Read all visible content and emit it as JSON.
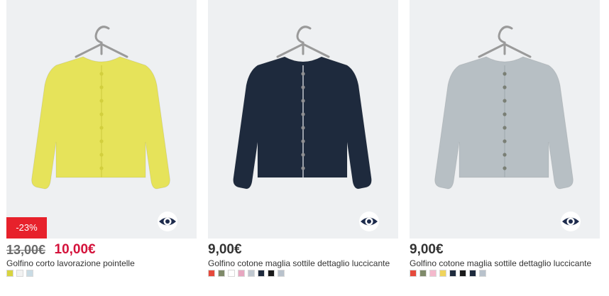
{
  "products": [
    {
      "old_price": "13,00€",
      "price": "10,00€",
      "discount_badge": "-23%",
      "title": "Golfino corto lavorazione pointelle",
      "garment_color": "#e6e35a",
      "button_color": "#d2cf3e",
      "trim_color": "#d9d64b",
      "swatches": [
        {
          "color": "#d8d43f"
        },
        {
          "color": "#f2f2f2"
        },
        {
          "color": "#c9dbe4"
        }
      ]
    },
    {
      "price": "9,00€",
      "title": "Golfino cotone maglia sottile dettaglio luccicante",
      "garment_color": "#1e2a3d",
      "button_color": "#8f8f92",
      "trim_color": "#9aa0aa",
      "swatches": [
        {
          "color": "#e64a3c"
        },
        {
          "color": "#7f8a6a"
        },
        {
          "color": "#ffffff"
        },
        {
          "color": "#e7a7c0"
        },
        {
          "color": "#bfc7cf"
        },
        {
          "color": "#1f2b3d"
        },
        {
          "color": "#1a1a1a"
        },
        {
          "color": "#b9c2cc"
        }
      ]
    },
    {
      "price": "9,00€",
      "title": "Golfino cotone maglia sottile dettaglio luccicante",
      "garment_color": "#b7bfc4",
      "button_color": "#7a7f75",
      "trim_color": "#aab3b8",
      "swatches": [
        {
          "color": "#e64a3c"
        },
        {
          "color": "#7f8a6a"
        },
        {
          "color": "#f4b9cc"
        },
        {
          "color": "#f0d45c"
        },
        {
          "color": "#1f2b3d"
        },
        {
          "color": "#1a1a1a"
        },
        {
          "color": "#1e2a3d"
        },
        {
          "color": "#b9c2cc"
        }
      ]
    }
  ],
  "icons": {
    "quick_view": "eye-icon",
    "hanger": "hanger-icon"
  }
}
